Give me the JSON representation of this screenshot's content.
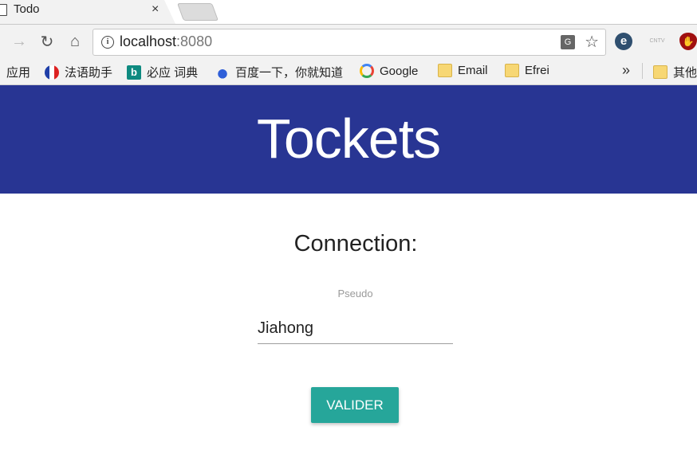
{
  "browser": {
    "tab_title": "Todo",
    "tab_close": "×",
    "url_host": "localhost",
    "url_port": ":8080",
    "bookmarks": {
      "apps": "应用",
      "fayu": "法语助手",
      "biying": "必应 词典",
      "baidu": "百度一下，你就知道",
      "google": "Google",
      "email": "Email",
      "efrei": "Efrei",
      "more": "»",
      "other": "其他"
    }
  },
  "page": {
    "banner_title": "Tockets",
    "heading": "Connection:",
    "pseudo_label": "Pseudo",
    "pseudo_value": "Jiahong",
    "submit_label": "VALIDER"
  },
  "colors": {
    "banner": "#283593",
    "button": "#26a69a"
  }
}
